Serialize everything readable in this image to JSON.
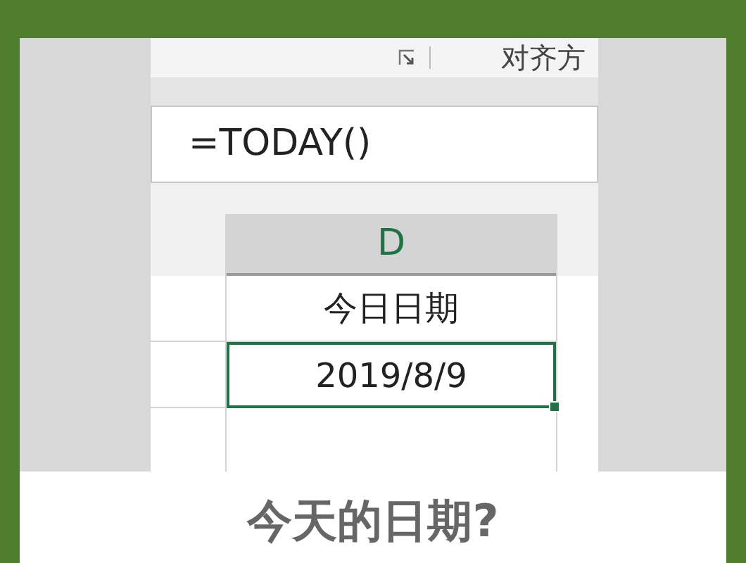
{
  "ribbon": {
    "group_label": "对齐方"
  },
  "formula_bar": {
    "value": "=TODAY()"
  },
  "sheet": {
    "column": "D",
    "rows": [
      {
        "value": "今日日期",
        "selected": false
      },
      {
        "value": "2019/8/9",
        "selected": true
      }
    ]
  },
  "caption": "今天的日期?"
}
